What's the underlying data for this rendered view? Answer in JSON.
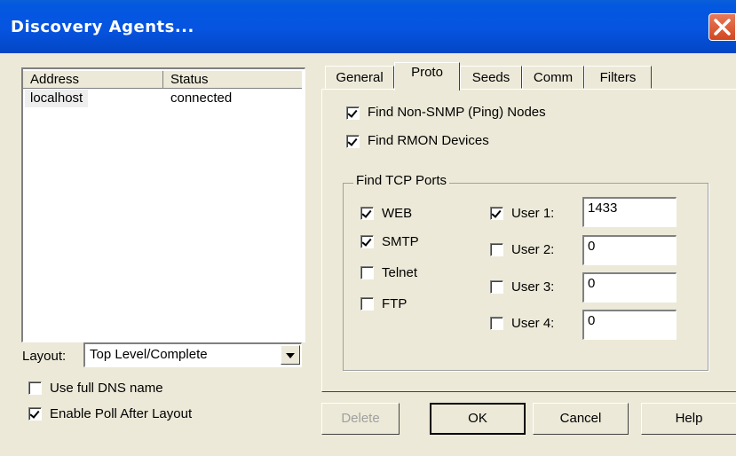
{
  "window": {
    "title": "Discovery Agents..."
  },
  "list": {
    "columns": [
      "Address",
      "Status"
    ],
    "rows": [
      {
        "address": "localhost",
        "status": "connected"
      }
    ]
  },
  "layout": {
    "label": "Layout:",
    "value": "Top Level/Complete"
  },
  "options": {
    "full_dns": {
      "label": "Use full DNS name",
      "checked": false
    },
    "poll_after": {
      "label": "Enable Poll After Layout",
      "checked": true
    }
  },
  "tabs": [
    "General",
    "Proto",
    "Seeds",
    "Comm",
    "Filters"
  ],
  "active_tab": "Proto",
  "proto": {
    "find_non_snmp": {
      "label": "Find Non-SNMP (Ping) Nodes",
      "checked": true
    },
    "find_rmon": {
      "label": "Find RMON Devices",
      "checked": true
    },
    "tcp_group_title": "Find TCP Ports",
    "ports": [
      {
        "label": "WEB",
        "checked": true
      },
      {
        "label": "SMTP",
        "checked": true
      },
      {
        "label": "Telnet",
        "checked": false
      },
      {
        "label": "FTP",
        "checked": false
      }
    ],
    "users": [
      {
        "label": "User 1:",
        "checked": true,
        "value": "1433"
      },
      {
        "label": "User 2:",
        "checked": false,
        "value": "0"
      },
      {
        "label": "User 3:",
        "checked": false,
        "value": "0"
      },
      {
        "label": "User 4:",
        "checked": false,
        "value": "0"
      }
    ]
  },
  "buttons": {
    "delete": "Delete",
    "ok": "OK",
    "cancel": "Cancel",
    "help": "Help"
  }
}
